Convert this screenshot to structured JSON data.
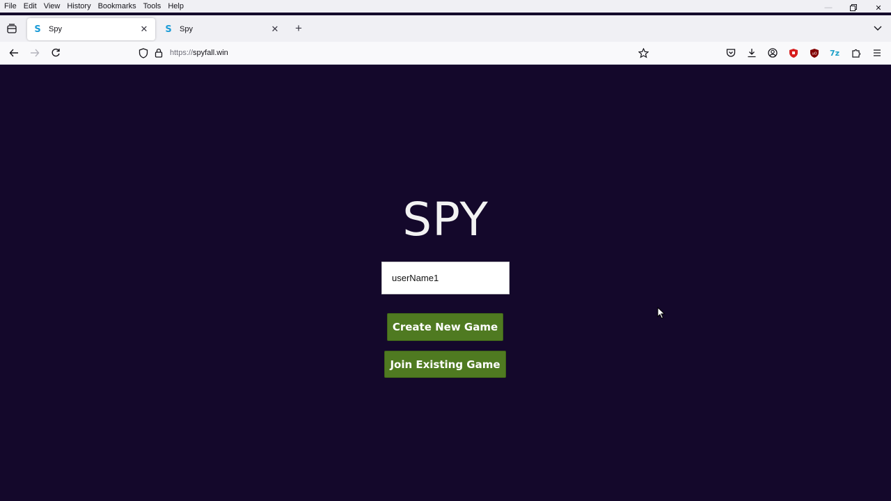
{
  "menubar": {
    "items": [
      "File",
      "Edit",
      "View",
      "History",
      "Bookmarks",
      "Tools",
      "Help"
    ]
  },
  "tabs": [
    {
      "title": "Spy",
      "favicon": "S",
      "active": true
    },
    {
      "title": "Spy",
      "favicon": "S",
      "active": false
    }
  ],
  "navbar": {
    "url_protocol": "https://",
    "url_host": "spyfall.win"
  },
  "page": {
    "title": "SPY",
    "username_value": "userName1",
    "create_button": "Create New Game",
    "join_button": "Join Existing Game"
  },
  "colors": {
    "page_bg": "#14082b",
    "button_bg": "#4f7a21",
    "favicon": "#1a9bd7"
  }
}
